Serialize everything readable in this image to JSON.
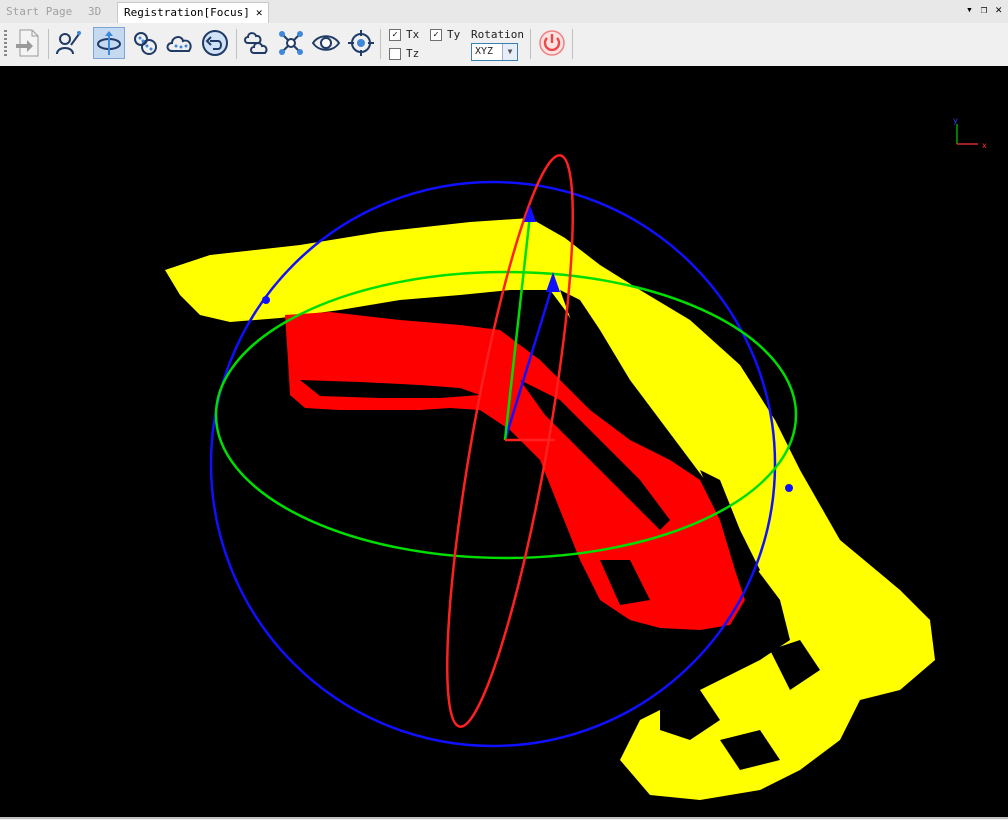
{
  "tabs": [
    {
      "label": "Start Page",
      "active": false
    },
    {
      "label": "3D",
      "active": false
    },
    {
      "label": "Registration[Focus]",
      "active": true
    }
  ],
  "tab_close_glyph": "✕",
  "window_controls": {
    "dropdown": "▾",
    "restore": "❐",
    "close": "✕"
  },
  "toolbar": {
    "buttons": [
      {
        "name": "import-icon"
      },
      {
        "name": "select-points-icon"
      },
      {
        "name": "rotate-icon",
        "selected": true
      },
      {
        "name": "point-cloud-dots-icon"
      },
      {
        "name": "cloud-icon"
      },
      {
        "name": "undo-icon"
      },
      {
        "name": "cloud-pair-icon"
      },
      {
        "name": "nodes-icon"
      },
      {
        "name": "eye-icon"
      },
      {
        "name": "target-icon"
      },
      {
        "name": "power-icon"
      }
    ],
    "tx": {
      "label": "Tx",
      "checked": true
    },
    "ty": {
      "label": "Ty",
      "checked": true
    },
    "tz": {
      "label": "Tz",
      "checked": false
    },
    "rotation_label": "Rotation",
    "rotation_value": "XYZ"
  },
  "axis_gizmo": {
    "x_label": "x",
    "y_label": "y"
  },
  "colors": {
    "reference_cloud": "#ffff00",
    "aligned_cloud": "#ff0000",
    "gizmo_x": "#ff2020",
    "gizmo_y": "#00dd00",
    "gizmo_z": "#1010ff",
    "viewport_bg": "#000000"
  }
}
